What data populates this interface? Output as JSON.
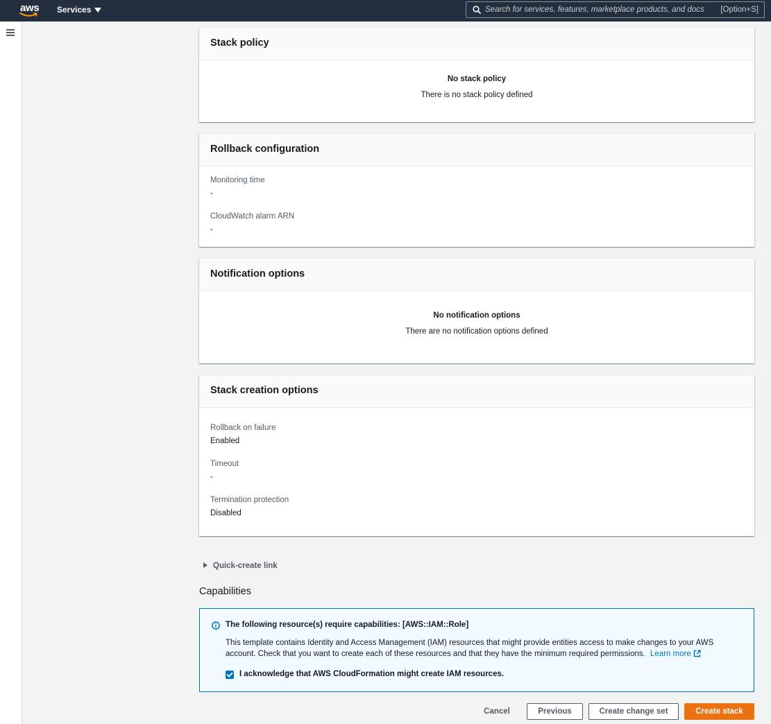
{
  "topbar": {
    "logo_text": "aws",
    "services_label": "Services",
    "search_placeholder": "Search for services, features, marketplace products, and docs",
    "search_shortcut": "[Option+S]"
  },
  "stack_policy": {
    "title": "Stack policy",
    "empty_title": "No stack policy",
    "empty_desc": "There is no stack policy defined"
  },
  "rollback": {
    "title": "Rollback configuration",
    "items": [
      {
        "label": "Monitoring time",
        "value": "-"
      },
      {
        "label": "CloudWatch alarm ARN",
        "value": "-"
      }
    ]
  },
  "notification": {
    "title": "Notification options",
    "empty_title": "No notification options",
    "empty_desc": "There are no notification options defined"
  },
  "creation_options": {
    "title": "Stack creation options",
    "items": [
      {
        "label": "Rollback on failure",
        "value": "Enabled"
      },
      {
        "label": "Timeout",
        "value": "-"
      },
      {
        "label": "Termination protection",
        "value": "Disabled"
      }
    ]
  },
  "quick_create": {
    "label": "Quick-create link"
  },
  "capabilities": {
    "heading": "Capabilities",
    "alert_title": "The following resource(s) require capabilities: [AWS::IAM::Role]",
    "alert_body": "This template contains Identity and Access Management (IAM) resources that might provide entities access to make changes to your AWS account. Check that you want to create each of these resources and that they have the minimum required permissions.",
    "learn_more": "Learn more",
    "acknowledge": "I acknowledge that AWS CloudFormation might create IAM resources.",
    "acknowledged": true
  },
  "footer": {
    "cancel": "Cancel",
    "previous": "Previous",
    "create_change_set": "Create change set",
    "create_stack": "Create stack"
  },
  "colors": {
    "topbar": "#232f3e",
    "primary_button": "#ec7211",
    "link": "#0073bb",
    "alert_background": "#f1faff"
  }
}
